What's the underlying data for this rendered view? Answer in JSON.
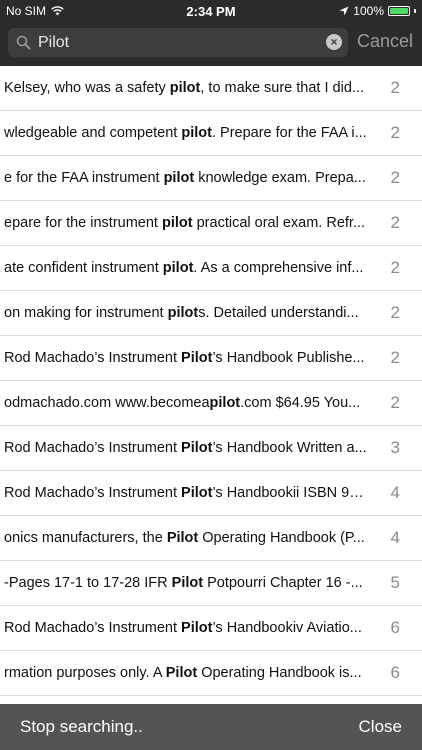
{
  "status": {
    "carrier": "No SIM",
    "time": "2:34 PM",
    "battery": "100%"
  },
  "search": {
    "query": "Pilot",
    "cancel_label": "Cancel"
  },
  "results": [
    {
      "before": "Kelsey, who was a safety ",
      "match": "pilot",
      "after": ", to make sure that I did...",
      "page": "2"
    },
    {
      "before": "wledgeable and competent ",
      "match": "pilot",
      "after": ". Prepare for the FAA i...",
      "page": "2"
    },
    {
      "before": "e for the FAA instrument ",
      "match": "pilot",
      "after": " knowledge exam. Prepa...",
      "page": "2"
    },
    {
      "before": "epare for the instrument ",
      "match": "pilot",
      "after": " practical oral exam. Refr...",
      "page": "2"
    },
    {
      "before": "ate confident instrument ",
      "match": "pilot",
      "after": ". As a comprehensive inf...",
      "page": "2"
    },
    {
      "before": "on making for instrument ",
      "match": "pilot",
      "after": "s. Detailed understandi...",
      "page": "2"
    },
    {
      "before": "Rod Machado’s Instrument ",
      "match": "Pilot",
      "after": "’s Handbook Publishe...",
      "page": "2"
    },
    {
      "before": "odmachado.com www.becomea",
      "match": "pilot",
      "after": ".com $64.95 You...",
      "page": "2"
    },
    {
      "before": "Rod Machado’s Instrument ",
      "match": "Pilot",
      "after": "’s Handbook Written a...",
      "page": "3"
    },
    {
      "before": "Rod Machado’s Instrument ",
      "match": "Pilot",
      "after": "’s Handbookii ISBN 97...",
      "page": "4"
    },
    {
      "before": "onics manufacturers, the ",
      "match": "Pilot",
      "after": " Operating Handbook (P...",
      "page": "4"
    },
    {
      "before": "-Pages 17-1 to 17-28 IFR ",
      "match": "Pilot",
      "after": " Potpourri Chapter 16 -...",
      "page": "5"
    },
    {
      "before": "Rod Machado’s Instrument ",
      "match": "Pilot",
      "after": "’s Handbookiv Aviatio...",
      "page": "6"
    },
    {
      "before": "rmation purposes only. A ",
      "match": "Pilot",
      "after": " Operating Handbook is...",
      "page": "6"
    }
  ],
  "footer": {
    "stop_label": "Stop searching..",
    "close_label": "Close"
  },
  "colors": {
    "top_bar": "#2b2b2b",
    "search_field": "#3d3d3d",
    "footer_bar": "#545454",
    "battery_fill": "#4cd964"
  }
}
